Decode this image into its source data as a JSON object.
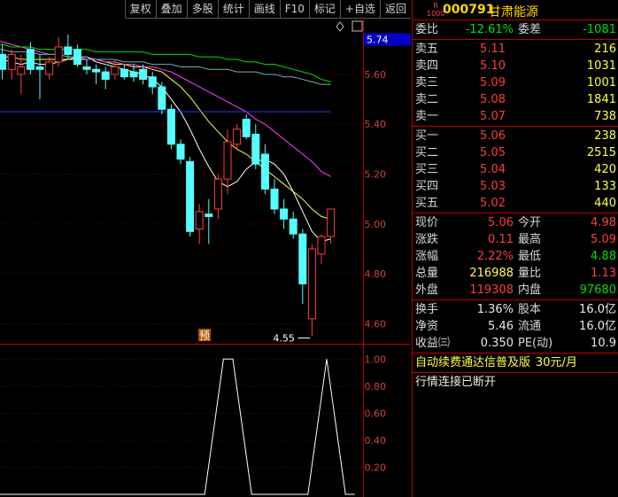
{
  "toolbar": {
    "buttons": [
      "复权",
      "叠加",
      "多股",
      "统计",
      "画线",
      "F10",
      "标记",
      "+自选",
      "返回"
    ]
  },
  "chart": {
    "price_axis": [
      "5.60",
      "5.40",
      "5.20",
      "5.00",
      "4.80",
      "4.60"
    ],
    "current_price_tag": "5.74",
    "low_marker": "4.55",
    "pre_badge": "预",
    "indicator_axis": [
      "1.00",
      "0.80",
      "0.60",
      "0.40",
      "0.20"
    ]
  },
  "chart_data": [
    {
      "type": "candlestick",
      "ylim": [
        4.52,
        5.82
      ],
      "candles": [
        {
          "o": 5.65,
          "h": 5.75,
          "l": 5.6,
          "c": 5.7
        },
        {
          "o": 5.68,
          "h": 5.72,
          "l": 5.58,
          "c": 5.62
        },
        {
          "o": 5.62,
          "h": 5.7,
          "l": 5.58,
          "c": 5.68
        },
        {
          "o": 5.6,
          "h": 5.68,
          "l": 5.52,
          "c": 5.63
        },
        {
          "o": 5.7,
          "h": 5.73,
          "l": 5.6,
          "c": 5.62
        },
        {
          "o": 5.63,
          "h": 5.68,
          "l": 5.5,
          "c": 5.62
        },
        {
          "o": 5.6,
          "h": 5.67,
          "l": 5.58,
          "c": 5.65
        },
        {
          "o": 5.65,
          "h": 5.75,
          "l": 5.63,
          "c": 5.71
        },
        {
          "o": 5.71,
          "h": 5.76,
          "l": 5.66,
          "c": 5.68
        },
        {
          "o": 5.7,
          "h": 5.72,
          "l": 5.63,
          "c": 5.64
        },
        {
          "o": 5.63,
          "h": 5.66,
          "l": 5.6,
          "c": 5.62
        },
        {
          "o": 5.62,
          "h": 5.64,
          "l": 5.56,
          "c": 5.61
        },
        {
          "o": 5.61,
          "h": 5.63,
          "l": 5.54,
          "c": 5.58
        },
        {
          "o": 5.6,
          "h": 5.66,
          "l": 5.58,
          "c": 5.63
        },
        {
          "o": 5.62,
          "h": 5.64,
          "l": 5.58,
          "c": 5.59
        },
        {
          "o": 5.61,
          "h": 5.64,
          "l": 5.57,
          "c": 5.59
        },
        {
          "o": 5.62,
          "h": 5.64,
          "l": 5.56,
          "c": 5.58
        },
        {
          "o": 5.59,
          "h": 5.61,
          "l": 5.52,
          "c": 5.55
        },
        {
          "o": 5.55,
          "h": 5.57,
          "l": 5.44,
          "c": 5.46
        },
        {
          "o": 5.46,
          "h": 5.48,
          "l": 5.3,
          "c": 5.32
        },
        {
          "o": 5.32,
          "h": 5.34,
          "l": 5.24,
          "c": 5.26
        },
        {
          "o": 5.25,
          "h": 5.27,
          "l": 4.95,
          "c": 4.97
        },
        {
          "o": 4.98,
          "h": 5.08,
          "l": 4.92,
          "c": 5.05
        },
        {
          "o": 5.04,
          "h": 5.1,
          "l": 4.92,
          "c": 5.03
        },
        {
          "o": 5.06,
          "h": 5.2,
          "l": 5.02,
          "c": 5.18
        },
        {
          "o": 5.18,
          "h": 5.38,
          "l": 5.12,
          "c": 5.33
        },
        {
          "o": 5.32,
          "h": 5.4,
          "l": 5.3,
          "c": 5.38
        },
        {
          "o": 5.42,
          "h": 5.44,
          "l": 5.34,
          "c": 5.35
        },
        {
          "o": 5.36,
          "h": 5.4,
          "l": 5.22,
          "c": 5.24
        },
        {
          "o": 5.28,
          "h": 5.32,
          "l": 5.12,
          "c": 5.14
        },
        {
          "o": 5.14,
          "h": 5.18,
          "l": 5.04,
          "c": 5.06
        },
        {
          "o": 5.06,
          "h": 5.1,
          "l": 4.98,
          "c": 5.02
        },
        {
          "o": 5.02,
          "h": 5.05,
          "l": 4.94,
          "c": 4.96
        },
        {
          "o": 4.96,
          "h": 4.98,
          "l": 4.68,
          "c": 4.76
        },
        {
          "o": 4.62,
          "h": 4.92,
          "l": 4.55,
          "c": 4.9
        },
        {
          "o": 4.88,
          "h": 4.96,
          "l": 4.84,
          "c": 4.95
        },
        {
          "o": 4.95,
          "h": 5.06,
          "l": 4.92,
          "c": 5.06
        }
      ],
      "ma_series": [
        {
          "color": "#ffffff",
          "values": [
            5.66,
            5.66,
            5.65,
            5.64,
            5.65,
            5.64,
            5.64,
            5.65,
            5.66,
            5.67,
            5.67,
            5.65,
            5.64,
            5.63,
            5.62,
            5.61,
            5.6,
            5.58,
            5.55,
            5.5,
            5.45,
            5.38,
            5.3,
            5.23,
            5.17,
            5.15,
            5.17,
            5.22,
            5.25,
            5.26,
            5.24,
            5.2,
            5.13,
            5.05,
            4.97,
            4.93,
            4.94
          ]
        },
        {
          "color": "#ffff40",
          "values": [
            5.68,
            5.67,
            5.67,
            5.66,
            5.66,
            5.66,
            5.66,
            5.66,
            5.66,
            5.66,
            5.66,
            5.66,
            5.65,
            5.64,
            5.64,
            5.63,
            5.63,
            5.62,
            5.61,
            5.58,
            5.55,
            5.51,
            5.46,
            5.41,
            5.37,
            5.33,
            5.3,
            5.28,
            5.25,
            5.22,
            5.19,
            5.16,
            5.13,
            5.1,
            5.06,
            5.03,
            5.02
          ]
        },
        {
          "color": "#ff40ff",
          "values": [
            5.74,
            5.73,
            5.72,
            5.71,
            5.7,
            5.69,
            5.68,
            5.68,
            5.67,
            5.67,
            5.66,
            5.66,
            5.65,
            5.65,
            5.64,
            5.64,
            5.63,
            5.63,
            5.62,
            5.61,
            5.59,
            5.57,
            5.55,
            5.53,
            5.51,
            5.49,
            5.47,
            5.45,
            5.42,
            5.4,
            5.37,
            5.34,
            5.31,
            5.28,
            5.25,
            5.21,
            5.19
          ]
        },
        {
          "color": "#00e000",
          "values": [
            5.72,
            5.72,
            5.71,
            5.71,
            5.71,
            5.7,
            5.7,
            5.7,
            5.7,
            5.7,
            5.7,
            5.69,
            5.69,
            5.69,
            5.69,
            5.69,
            5.69,
            5.68,
            5.68,
            5.68,
            5.68,
            5.68,
            5.67,
            5.67,
            5.67,
            5.66,
            5.66,
            5.65,
            5.65,
            5.64,
            5.64,
            5.63,
            5.62,
            5.61,
            5.6,
            5.58,
            5.57
          ]
        },
        {
          "color": "#6fb0b0",
          "values": [
            5.7,
            5.7,
            5.69,
            5.69,
            5.69,
            5.68,
            5.68,
            5.68,
            5.67,
            5.67,
            5.67,
            5.66,
            5.66,
            5.66,
            5.65,
            5.65,
            5.65,
            5.64,
            5.64,
            5.64,
            5.63,
            5.63,
            5.63,
            5.62,
            5.62,
            5.62,
            5.61,
            5.61,
            5.61,
            5.6,
            5.6,
            5.59,
            5.59,
            5.58,
            5.57,
            5.56,
            5.56
          ]
        },
        {
          "color": "#3030ff",
          "values": [
            5.45,
            5.45,
            5.45,
            5.45,
            5.45,
            5.45,
            5.45,
            5.45,
            5.45,
            5.45,
            5.45,
            5.45,
            5.45,
            5.45,
            5.45,
            5.45,
            5.45,
            5.45,
            5.45,
            5.45,
            5.45,
            5.45,
            5.45,
            5.45,
            5.45,
            5.45,
            5.45,
            5.45,
            5.45,
            5.45,
            5.45,
            5.45,
            5.45,
            5.45,
            5.45,
            5.45,
            5.45
          ]
        }
      ]
    },
    {
      "type": "line",
      "ylim": [
        0,
        1.1
      ],
      "values": [
        0,
        0,
        0,
        0,
        0,
        0,
        0,
        0,
        0,
        0,
        0,
        0,
        0,
        0,
        0,
        0,
        0,
        0,
        0,
        0,
        0,
        0,
        0,
        0.5,
        1,
        1,
        0.5,
        0,
        0,
        0,
        0,
        0,
        0,
        0,
        0.5,
        1,
        0.5,
        0,
        0
      ]
    }
  ],
  "panel": {
    "code": "000791",
    "name": "甘肃能源",
    "badge_r": "R",
    "badge_num": "1000",
    "weibi": {
      "label": "委比",
      "value": "-12.61%",
      "label2": "委差",
      "value2": "-1081"
    },
    "asks": [
      {
        "label": "卖五",
        "price": "5.11",
        "vol": "216"
      },
      {
        "label": "卖四",
        "price": "5.10",
        "vol": "1031"
      },
      {
        "label": "卖三",
        "price": "5.09",
        "vol": "1001"
      },
      {
        "label": "卖二",
        "price": "5.08",
        "vol": "1841"
      },
      {
        "label": "卖一",
        "price": "5.07",
        "vol": "738"
      }
    ],
    "bids": [
      {
        "label": "买一",
        "price": "5.06",
        "vol": "238"
      },
      {
        "label": "买二",
        "price": "5.05",
        "vol": "2515"
      },
      {
        "label": "买三",
        "price": "5.04",
        "vol": "420"
      },
      {
        "label": "买四",
        "price": "5.03",
        "vol": "133"
      },
      {
        "label": "买五",
        "price": "5.02",
        "vol": "440"
      }
    ],
    "quote": [
      {
        "l1": "现价",
        "v1": "5.06",
        "c1": "red",
        "l2": "今开",
        "v2": "4.98",
        "c2": "red"
      },
      {
        "l1": "涨跌",
        "v1": "0.11",
        "c1": "red",
        "l2": "最高",
        "v2": "5.09",
        "c2": "red"
      },
      {
        "l1": "涨幅",
        "v1": "2.22%",
        "c1": "red",
        "l2": "最低",
        "v2": "4.88",
        "c2": "green"
      },
      {
        "l1": "总量",
        "v1": "216988",
        "c1": "yellow",
        "l2": "量比",
        "v2": "1.13",
        "c2": "red"
      },
      {
        "l1": "外盘",
        "v1": "119308",
        "c1": "red",
        "l2": "内盘",
        "v2": "97680",
        "c2": "green"
      }
    ],
    "fund": [
      {
        "l1": "换手",
        "v1": "1.36%",
        "l2": "股本",
        "v2": "16.0亿"
      },
      {
        "l1": "净资",
        "v1": "5.46",
        "l2": "流通",
        "v2": "16.0亿"
      },
      {
        "l1": "收益㈢",
        "v1": "0.350",
        "l2": "PE(动)",
        "v2": "10.9"
      }
    ],
    "notice": {
      "text": "自动续费通达信普及版",
      "price": "30元/月"
    },
    "status": "行情连接已断开"
  }
}
